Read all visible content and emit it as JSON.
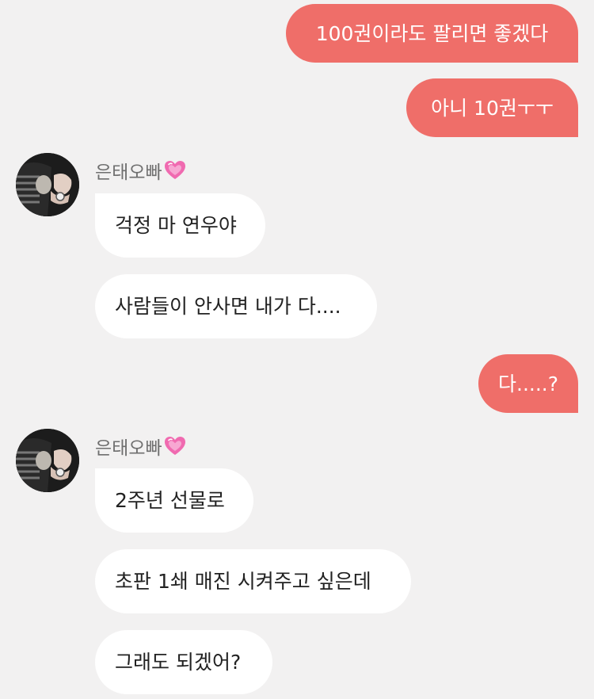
{
  "colors": {
    "background": "#f2f1f1",
    "my_bubble": "#ef6e69",
    "their_bubble": "#ffffff",
    "name_text": "#6f6f6f",
    "heart": "#f06ab0"
  },
  "messages": {
    "m1": "100권이라도 팔리면 좋겠다",
    "m2": "아니 10권ㅜㅜ",
    "m3": "걱정 마 연우야",
    "m4": "사람들이 안사면 내가 다....",
    "m5": "다.....?",
    "m6": "2주년 선물로",
    "m7": "초판 1쇄 매진 시켜주고 싶은데",
    "m8": "그래도 되겠어?"
  },
  "sender": {
    "name": "은태오빠",
    "name_icon": "heart-icon"
  }
}
